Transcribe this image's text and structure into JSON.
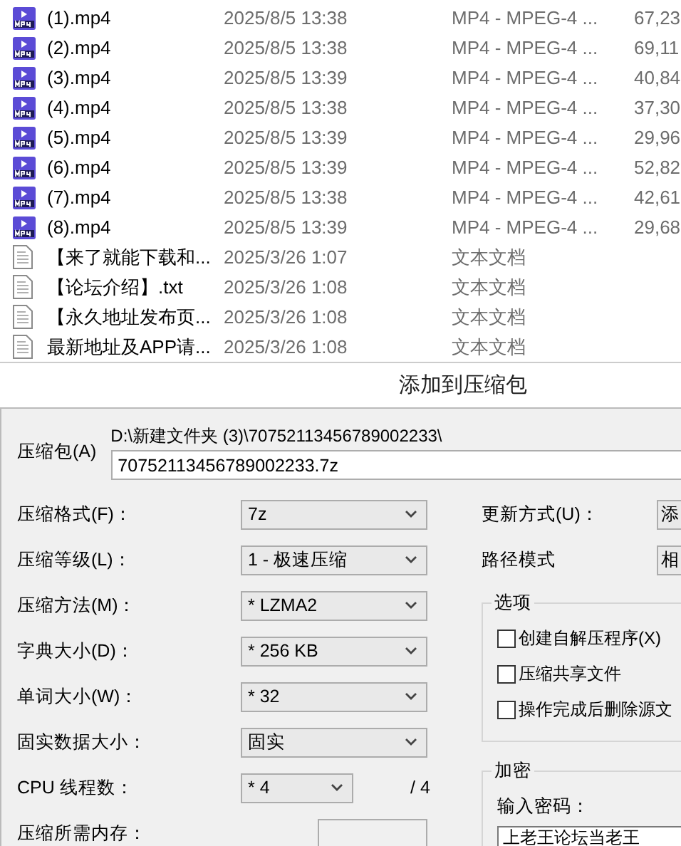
{
  "files": [
    {
      "kind": "video",
      "name": "(1).mp4",
      "date": "2025/8/5 13:38",
      "type": "MP4 - MPEG-4 ...",
      "size": "67,23"
    },
    {
      "kind": "video",
      "name": "(2).mp4",
      "date": "2025/8/5 13:38",
      "type": "MP4 - MPEG-4 ...",
      "size": "69,11"
    },
    {
      "kind": "video",
      "name": "(3).mp4",
      "date": "2025/8/5 13:39",
      "type": "MP4 - MPEG-4 ...",
      "size": "40,84"
    },
    {
      "kind": "video",
      "name": "(4).mp4",
      "date": "2025/8/5 13:38",
      "type": "MP4 - MPEG-4 ...",
      "size": "37,30"
    },
    {
      "kind": "video",
      "name": "(5).mp4",
      "date": "2025/8/5 13:39",
      "type": "MP4 - MPEG-4 ...",
      "size": "29,96"
    },
    {
      "kind": "video",
      "name": "(6).mp4",
      "date": "2025/8/5 13:39",
      "type": "MP4 - MPEG-4 ...",
      "size": "52,82"
    },
    {
      "kind": "video",
      "name": "(7).mp4",
      "date": "2025/8/5 13:38",
      "type": "MP4 - MPEG-4 ...",
      "size": "42,61"
    },
    {
      "kind": "video",
      "name": "(8).mp4",
      "date": "2025/8/5 13:39",
      "type": "MP4 - MPEG-4 ...",
      "size": "29,68"
    },
    {
      "kind": "text",
      "name": "【来了就能下载和...",
      "date": "2025/3/26 1:07",
      "type": "文本文档"
    },
    {
      "kind": "text",
      "name": "【论坛介绍】.txt",
      "date": "2025/3/26 1:08",
      "type": "文本文档"
    },
    {
      "kind": "text",
      "name": "【永久地址发布页...",
      "date": "2025/3/26 1:08",
      "type": "文本文档"
    },
    {
      "kind": "text",
      "name": "最新地址及APP请...",
      "date": "2025/3/26 1:08",
      "type": "文本文档"
    }
  ],
  "dialog": {
    "title": "添加到压缩包",
    "archive": {
      "label": "压缩包(A)",
      "path": "D:\\新建文件夹 (3)\\70752113456789002233\\",
      "value": "70752113456789002233.7z"
    },
    "settings": [
      {
        "kind": "select",
        "label": "压缩格式(F)：",
        "value": "7z"
      },
      {
        "kind": "select",
        "label": "压缩等级(L)：",
        "value": "1 - 极速压缩"
      },
      {
        "kind": "select",
        "label": "压缩方法(M)：",
        "value": "* LZMA2"
      },
      {
        "kind": "select",
        "label": "字典大小(D)：",
        "value": "* 256 KB"
      },
      {
        "kind": "select",
        "label": "单词大小(W)：",
        "value": "* 32"
      },
      {
        "kind": "select",
        "label": "固实数据大小：",
        "value": "固实"
      },
      {
        "kind": "small_select",
        "label": "CPU 线程数：",
        "value": "* 4",
        "suffix": "/ 4"
      },
      {
        "kind": "readout",
        "label": "压缩所需内存："
      }
    ],
    "right_settings": [
      {
        "label": "更新方式(U)：",
        "value": "添"
      },
      {
        "label": "路径模式",
        "value": "相"
      }
    ],
    "options": {
      "title": "选项",
      "items": [
        {
          "label": "创建自解压程序(X)",
          "checked": false
        },
        {
          "label": "压缩共享文件",
          "checked": false
        },
        {
          "label": "操作完成后删除源文",
          "checked": false
        }
      ]
    },
    "encryption": {
      "title": "加密",
      "password_label": "输入密码：",
      "password": "上老王论坛当老王"
    }
  }
}
